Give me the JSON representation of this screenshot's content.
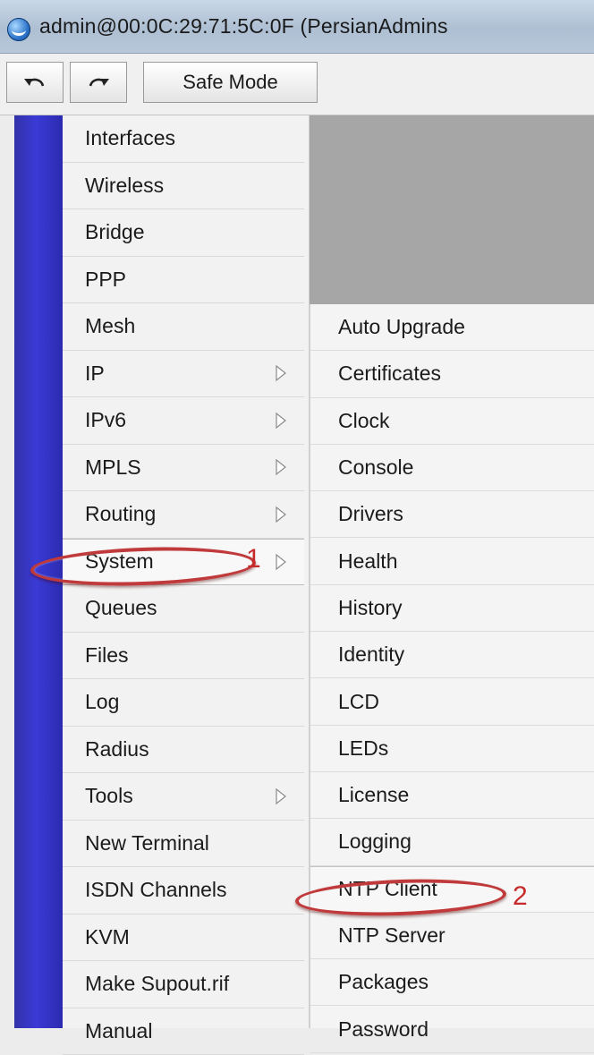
{
  "window": {
    "title": "admin@00:0C:29:71:5C:0F (PersianAdmins"
  },
  "toolbar": {
    "safe_mode_label": "Safe Mode"
  },
  "main_menu": {
    "items": [
      {
        "label": "Interfaces",
        "has_submenu": false
      },
      {
        "label": "Wireless",
        "has_submenu": false
      },
      {
        "label": "Bridge",
        "has_submenu": false
      },
      {
        "label": "PPP",
        "has_submenu": false
      },
      {
        "label": "Mesh",
        "has_submenu": false
      },
      {
        "label": "IP",
        "has_submenu": true
      },
      {
        "label": "IPv6",
        "has_submenu": true
      },
      {
        "label": "MPLS",
        "has_submenu": true
      },
      {
        "label": "Routing",
        "has_submenu": true
      },
      {
        "label": "System",
        "has_submenu": true,
        "selected": true
      },
      {
        "label": "Queues",
        "has_submenu": false
      },
      {
        "label": "Files",
        "has_submenu": false
      },
      {
        "label": "Log",
        "has_submenu": false
      },
      {
        "label": "Radius",
        "has_submenu": false
      },
      {
        "label": "Tools",
        "has_submenu": true
      },
      {
        "label": "New Terminal",
        "has_submenu": false
      },
      {
        "label": "ISDN Channels",
        "has_submenu": false
      },
      {
        "label": "KVM",
        "has_submenu": false
      },
      {
        "label": "Make Supout.rif",
        "has_submenu": false
      },
      {
        "label": "Manual",
        "has_submenu": false
      }
    ]
  },
  "system_submenu": {
    "items": [
      {
        "label": "Auto Upgrade"
      },
      {
        "label": "Certificates"
      },
      {
        "label": "Clock"
      },
      {
        "label": "Console"
      },
      {
        "label": "Drivers"
      },
      {
        "label": "Health"
      },
      {
        "label": "History"
      },
      {
        "label": "Identity"
      },
      {
        "label": "LCD"
      },
      {
        "label": "LEDs"
      },
      {
        "label": "License"
      },
      {
        "label": "Logging"
      },
      {
        "label": "NTP Client",
        "selected": true
      },
      {
        "label": "NTP Server"
      },
      {
        "label": "Packages"
      },
      {
        "label": "Password"
      }
    ]
  },
  "annotations": {
    "step1": "1",
    "step2": "2",
    "color": "#c0393b"
  },
  "colors": {
    "brand_strip": "#3a3ad6",
    "workspace": "#a6a6a6"
  },
  "icons": {
    "window": "winbox-icon",
    "undo": "undo-icon",
    "redo": "redo-icon",
    "submenu": "submenu-arrow-icon"
  }
}
